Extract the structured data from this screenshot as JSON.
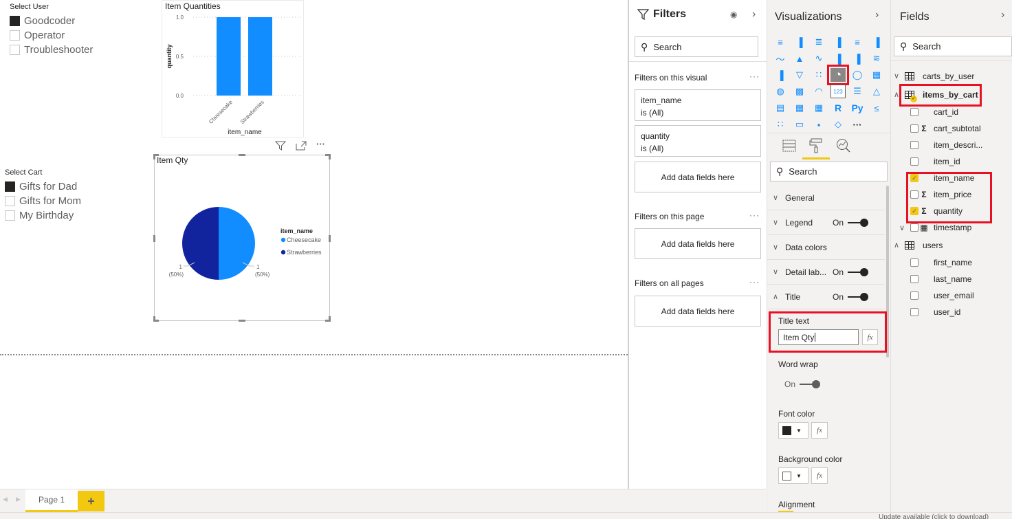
{
  "canvas": {
    "user_slicer": {
      "title": "Select User",
      "items": [
        {
          "label": "Goodcoder",
          "checked": true
        },
        {
          "label": "Operator",
          "checked": false
        },
        {
          "label": "Troubleshooter",
          "checked": false
        }
      ]
    },
    "cart_slicer": {
      "title": "Select Cart",
      "items": [
        {
          "label": "Gifts for Dad",
          "checked": true
        },
        {
          "label": "Gifts for Mom",
          "checked": false
        },
        {
          "label": "My Birthday",
          "checked": false
        }
      ]
    },
    "visual_header_icons": [
      "filter-icon",
      "focus-mode-icon",
      "more-options-icon"
    ],
    "more_glyph": "···"
  },
  "chart_data": [
    {
      "type": "bar",
      "title": "Item Quantities",
      "categories": [
        "Cheesecake",
        "Strawberries"
      ],
      "values": [
        1,
        1
      ],
      "xlabel": "item_name",
      "ylabel": "quantity",
      "ylim": [
        0,
        1
      ],
      "yticks": [
        "0.0",
        "0.5",
        "1.0"
      ],
      "grid": true,
      "color": "#118dff"
    },
    {
      "type": "pie",
      "title": "Item Qty",
      "categories": [
        "Cheesecake",
        "Strawberries"
      ],
      "values": [
        1,
        1
      ],
      "labels": [
        "1",
        "1"
      ],
      "percent_labels": [
        "(50%)",
        "(50%)"
      ],
      "colors": [
        "#118dff",
        "#12239e"
      ],
      "legend_title": "item_name",
      "legend_position": "right"
    }
  ],
  "pagebar": {
    "tabs": [
      {
        "label": "Page 1",
        "active": true
      }
    ],
    "add_label": "+"
  },
  "statusbar": {
    "text": "Update available (click to download)"
  },
  "filters": {
    "title": "Filters",
    "search_placeholder": "Search",
    "sections": [
      {
        "label": "Filters on this visual",
        "cards": [
          {
            "field": "item_name",
            "state": "is (All)"
          },
          {
            "field": "quantity",
            "state": "is (All)"
          }
        ],
        "add": "Add data fields here"
      },
      {
        "label": "Filters on this page",
        "cards": [],
        "add": "Add data fields here"
      },
      {
        "label": "Filters on all pages",
        "cards": [],
        "add": "Add data fields here"
      }
    ]
  },
  "visualizations": {
    "title": "Visualizations",
    "icons": [
      "stacked-bar-chart-icon",
      "stacked-column-chart-icon",
      "clustered-bar-chart-icon",
      "clustered-column-chart-icon",
      "100-stacked-bar-chart-icon",
      "100-stacked-column-chart-icon",
      "line-chart-icon",
      "area-chart-icon",
      "stacked-area-chart-icon",
      "line-and-stacked-column-icon",
      "line-and-clustered-column-icon",
      "ribbon-chart-icon",
      "waterfall-chart-icon",
      "funnel-icon",
      "scatter-chart-icon",
      "pie-chart-icon",
      "donut-chart-icon",
      "treemap-icon",
      "map-icon",
      "filled-map-icon",
      "gauge-icon",
      "card-icon",
      "multi-row-card-icon",
      "kpi-icon",
      "slicer-icon",
      "table-icon",
      "matrix-icon",
      "r-visual-icon",
      "python-visual-icon",
      "key-influencers-icon",
      "decomposition-tree-icon",
      "qa-icon",
      "arcgis-icon",
      "power-apps-icon",
      "more-visuals-icon"
    ],
    "icon_glyphs": [
      "≡",
      "▐",
      "≣",
      "▐",
      "≡",
      "▐",
      "〜",
      "▲",
      "∿",
      "▐",
      "▐",
      "≋",
      "▐",
      "▽",
      "∷",
      "◔",
      "◯",
      "▦",
      "◍",
      "▩",
      "◠",
      "123",
      "☰",
      "△",
      "▤",
      "▦",
      "▦",
      "R",
      "Py",
      "≤",
      "∷",
      "▭",
      "▪",
      "◇",
      "···"
    ],
    "selected_icon": "pie-chart-icon",
    "tabs": [
      "fields-tab",
      "format-tab",
      "analytics-tab"
    ],
    "active_tab": "format-tab",
    "search_placeholder": "Search",
    "format_sections": [
      {
        "label": "General",
        "expanded": false,
        "toggle": null
      },
      {
        "label": "Legend",
        "expanded": false,
        "toggle": "On"
      },
      {
        "label": "Data colors",
        "expanded": false,
        "toggle": null
      },
      {
        "label": "Detail lab...",
        "expanded": false,
        "toggle": "On"
      },
      {
        "label": "Title",
        "expanded": true,
        "toggle": "On"
      }
    ],
    "title_text_label": "Title text",
    "title_text_value": "Item Qty",
    "fx_label": "fx",
    "word_wrap_label": "Word wrap",
    "word_wrap_state": "On",
    "font_color_label": "Font color",
    "font_color": "#252423",
    "background_color_label": "Background color",
    "background_color": "#ffffff",
    "alignment_label": "Alignment"
  },
  "fields": {
    "title": "Fields",
    "search_placeholder": "Search",
    "tables": [
      {
        "name": "carts_by_user",
        "expanded": false,
        "fields": []
      },
      {
        "name": "items_by_cart",
        "expanded": true,
        "in_use": true,
        "fields": [
          {
            "name": "cart_id",
            "checked": false,
            "sigma": false
          },
          {
            "name": "cart_subtotal",
            "checked": false,
            "sigma": true
          },
          {
            "name": "item_descri...",
            "checked": false,
            "sigma": false
          },
          {
            "name": "item_id",
            "checked": false,
            "sigma": false
          },
          {
            "name": "item_name",
            "checked": true,
            "sigma": false
          },
          {
            "name": "item_price",
            "checked": false,
            "sigma": true
          },
          {
            "name": "quantity",
            "checked": true,
            "sigma": true
          },
          {
            "name": "timestamp",
            "checked": false,
            "sigma": false,
            "calendar": true
          }
        ]
      },
      {
        "name": "users",
        "expanded": true,
        "fields": [
          {
            "name": "first_name",
            "checked": false,
            "sigma": false
          },
          {
            "name": "last_name",
            "checked": false,
            "sigma": false
          },
          {
            "name": "user_email",
            "checked": false,
            "sigma": false
          },
          {
            "name": "user_id",
            "checked": false,
            "sigma": false
          }
        ]
      }
    ]
  }
}
